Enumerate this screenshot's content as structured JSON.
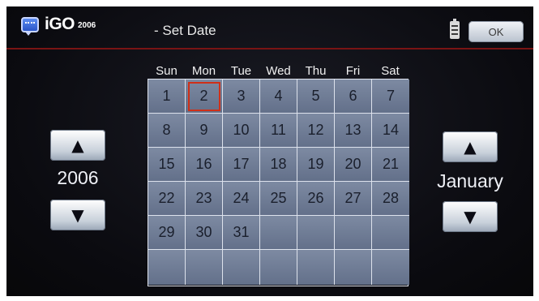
{
  "header": {
    "app_name": "iGO",
    "app_version": "2006",
    "page_title": "- Set Date",
    "ok_label": "OK"
  },
  "calendar": {
    "day_headers": [
      "Sun",
      "Mon",
      "Tue",
      "Wed",
      "Thu",
      "Fri",
      "Sat"
    ],
    "days": [
      "1",
      "2",
      "3",
      "4",
      "5",
      "6",
      "7",
      "8",
      "9",
      "10",
      "11",
      "12",
      "13",
      "14",
      "15",
      "16",
      "17",
      "18",
      "19",
      "20",
      "21",
      "22",
      "23",
      "24",
      "25",
      "26",
      "27",
      "28",
      "29",
      "30",
      "31"
    ],
    "selected_day": "2"
  },
  "year_stepper": {
    "value": "2006",
    "up_icon": "▲",
    "down_icon": "▼"
  },
  "month_stepper": {
    "value": "January",
    "up_icon": "▲",
    "down_icon": "▼"
  },
  "colors": {
    "header_rule": "#7a1414",
    "selected_outline": "#d03018",
    "cell_fill": "#6e7b94"
  }
}
